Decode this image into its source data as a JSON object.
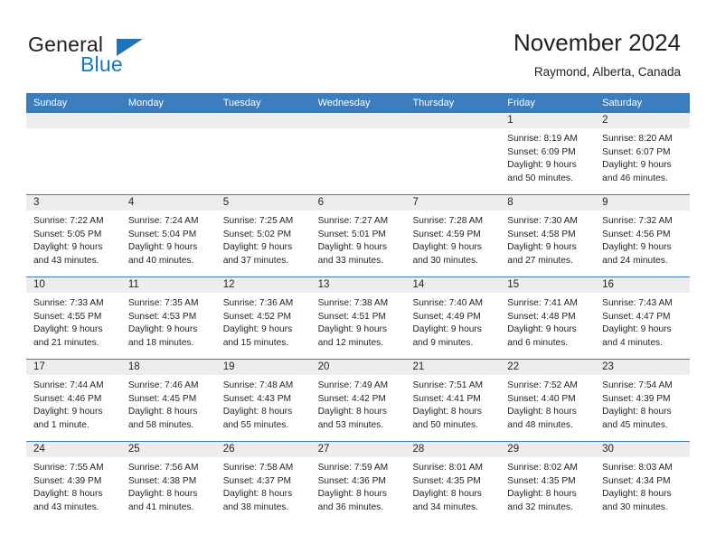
{
  "brand": {
    "word1": "General",
    "word2": "Blue",
    "accent_color": "#1b75bc"
  },
  "header": {
    "title": "November 2024",
    "subtitle": "Raymond, Alberta, Canada"
  },
  "theme": {
    "header_blue": "#3b7dbf",
    "day_band_gray": "#ededed",
    "text": "#231f20"
  },
  "calendar": {
    "day_names": [
      "Sunday",
      "Monday",
      "Tuesday",
      "Wednesday",
      "Thursday",
      "Friday",
      "Saturday"
    ],
    "weeks": [
      [
        {
          "day": "",
          "lines": []
        },
        {
          "day": "",
          "lines": []
        },
        {
          "day": "",
          "lines": []
        },
        {
          "day": "",
          "lines": []
        },
        {
          "day": "",
          "lines": []
        },
        {
          "day": "1",
          "lines": [
            "Sunrise: 8:19 AM",
            "Sunset: 6:09 PM",
            "Daylight: 9 hours",
            "and 50 minutes."
          ]
        },
        {
          "day": "2",
          "lines": [
            "Sunrise: 8:20 AM",
            "Sunset: 6:07 PM",
            "Daylight: 9 hours",
            "and 46 minutes."
          ]
        }
      ],
      [
        {
          "day": "3",
          "lines": [
            "Sunrise: 7:22 AM",
            "Sunset: 5:05 PM",
            "Daylight: 9 hours",
            "and 43 minutes."
          ]
        },
        {
          "day": "4",
          "lines": [
            "Sunrise: 7:24 AM",
            "Sunset: 5:04 PM",
            "Daylight: 9 hours",
            "and 40 minutes."
          ]
        },
        {
          "day": "5",
          "lines": [
            "Sunrise: 7:25 AM",
            "Sunset: 5:02 PM",
            "Daylight: 9 hours",
            "and 37 minutes."
          ]
        },
        {
          "day": "6",
          "lines": [
            "Sunrise: 7:27 AM",
            "Sunset: 5:01 PM",
            "Daylight: 9 hours",
            "and 33 minutes."
          ]
        },
        {
          "day": "7",
          "lines": [
            "Sunrise: 7:28 AM",
            "Sunset: 4:59 PM",
            "Daylight: 9 hours",
            "and 30 minutes."
          ]
        },
        {
          "day": "8",
          "lines": [
            "Sunrise: 7:30 AM",
            "Sunset: 4:58 PM",
            "Daylight: 9 hours",
            "and 27 minutes."
          ]
        },
        {
          "day": "9",
          "lines": [
            "Sunrise: 7:32 AM",
            "Sunset: 4:56 PM",
            "Daylight: 9 hours",
            "and 24 minutes."
          ]
        }
      ],
      [
        {
          "day": "10",
          "lines": [
            "Sunrise: 7:33 AM",
            "Sunset: 4:55 PM",
            "Daylight: 9 hours",
            "and 21 minutes."
          ]
        },
        {
          "day": "11",
          "lines": [
            "Sunrise: 7:35 AM",
            "Sunset: 4:53 PM",
            "Daylight: 9 hours",
            "and 18 minutes."
          ]
        },
        {
          "day": "12",
          "lines": [
            "Sunrise: 7:36 AM",
            "Sunset: 4:52 PM",
            "Daylight: 9 hours",
            "and 15 minutes."
          ]
        },
        {
          "day": "13",
          "lines": [
            "Sunrise: 7:38 AM",
            "Sunset: 4:51 PM",
            "Daylight: 9 hours",
            "and 12 minutes."
          ]
        },
        {
          "day": "14",
          "lines": [
            "Sunrise: 7:40 AM",
            "Sunset: 4:49 PM",
            "Daylight: 9 hours",
            "and 9 minutes."
          ]
        },
        {
          "day": "15",
          "lines": [
            "Sunrise: 7:41 AM",
            "Sunset: 4:48 PM",
            "Daylight: 9 hours",
            "and 6 minutes."
          ]
        },
        {
          "day": "16",
          "lines": [
            "Sunrise: 7:43 AM",
            "Sunset: 4:47 PM",
            "Daylight: 9 hours",
            "and 4 minutes."
          ]
        }
      ],
      [
        {
          "day": "17",
          "lines": [
            "Sunrise: 7:44 AM",
            "Sunset: 4:46 PM",
            "Daylight: 9 hours",
            "and 1 minute."
          ]
        },
        {
          "day": "18",
          "lines": [
            "Sunrise: 7:46 AM",
            "Sunset: 4:45 PM",
            "Daylight: 8 hours",
            "and 58 minutes."
          ]
        },
        {
          "day": "19",
          "lines": [
            "Sunrise: 7:48 AM",
            "Sunset: 4:43 PM",
            "Daylight: 8 hours",
            "and 55 minutes."
          ]
        },
        {
          "day": "20",
          "lines": [
            "Sunrise: 7:49 AM",
            "Sunset: 4:42 PM",
            "Daylight: 8 hours",
            "and 53 minutes."
          ]
        },
        {
          "day": "21",
          "lines": [
            "Sunrise: 7:51 AM",
            "Sunset: 4:41 PM",
            "Daylight: 8 hours",
            "and 50 minutes."
          ]
        },
        {
          "day": "22",
          "lines": [
            "Sunrise: 7:52 AM",
            "Sunset: 4:40 PM",
            "Daylight: 8 hours",
            "and 48 minutes."
          ]
        },
        {
          "day": "23",
          "lines": [
            "Sunrise: 7:54 AM",
            "Sunset: 4:39 PM",
            "Daylight: 8 hours",
            "and 45 minutes."
          ]
        }
      ],
      [
        {
          "day": "24",
          "lines": [
            "Sunrise: 7:55 AM",
            "Sunset: 4:39 PM",
            "Daylight: 8 hours",
            "and 43 minutes."
          ]
        },
        {
          "day": "25",
          "lines": [
            "Sunrise: 7:56 AM",
            "Sunset: 4:38 PM",
            "Daylight: 8 hours",
            "and 41 minutes."
          ]
        },
        {
          "day": "26",
          "lines": [
            "Sunrise: 7:58 AM",
            "Sunset: 4:37 PM",
            "Daylight: 8 hours",
            "and 38 minutes."
          ]
        },
        {
          "day": "27",
          "lines": [
            "Sunrise: 7:59 AM",
            "Sunset: 4:36 PM",
            "Daylight: 8 hours",
            "and 36 minutes."
          ]
        },
        {
          "day": "28",
          "lines": [
            "Sunrise: 8:01 AM",
            "Sunset: 4:35 PM",
            "Daylight: 8 hours",
            "and 34 minutes."
          ]
        },
        {
          "day": "29",
          "lines": [
            "Sunrise: 8:02 AM",
            "Sunset: 4:35 PM",
            "Daylight: 8 hours",
            "and 32 minutes."
          ]
        },
        {
          "day": "30",
          "lines": [
            "Sunrise: 8:03 AM",
            "Sunset: 4:34 PM",
            "Daylight: 8 hours",
            "and 30 minutes."
          ]
        }
      ]
    ]
  }
}
